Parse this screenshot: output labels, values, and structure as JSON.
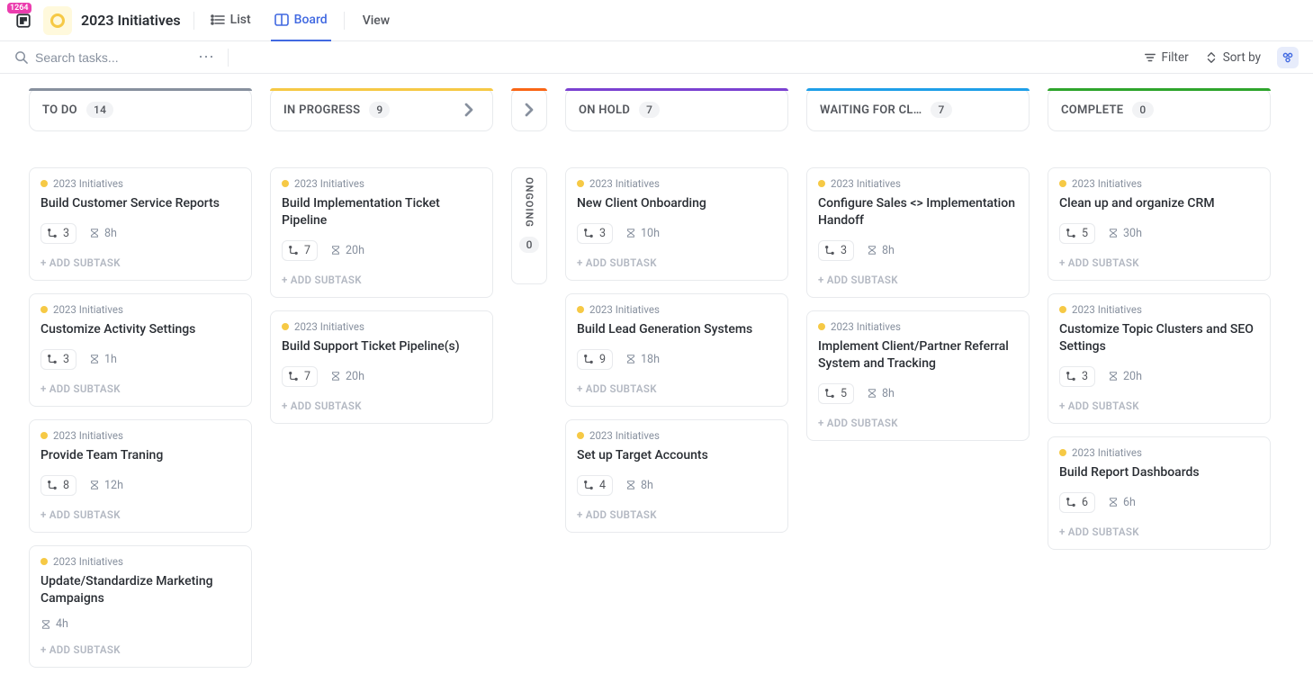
{
  "app_badge_count": "1264",
  "page_title": "2023 Initiatives",
  "tabs": {
    "list": "List",
    "board": "Board",
    "add_view": "View"
  },
  "toolbar": {
    "search_placeholder": "Search tasks...",
    "filter": "Filter",
    "sort": "Sort by"
  },
  "tag_label": "2023 Initiatives",
  "add_subtask_label": "+ ADD SUBTASK",
  "columns": {
    "todo": {
      "label": "TO DO",
      "count": "14"
    },
    "inprogress": {
      "label": "IN PROGRESS",
      "count": "9"
    },
    "ongoing": {
      "label": "ONGOING",
      "count": "0"
    },
    "onhold": {
      "label": "ON HOLD",
      "count": "7"
    },
    "waiting": {
      "label": "WAITING FOR CL…",
      "count": "7"
    },
    "complete": {
      "label": "COMPLETE",
      "count": "0"
    }
  },
  "cards": {
    "todo": [
      {
        "title": "Build Customer Service Reports",
        "sub": "3",
        "est": "8h"
      },
      {
        "title": "Customize Activity Settings",
        "sub": "3",
        "est": "1h"
      },
      {
        "title": "Provide Team Traning",
        "sub": "8",
        "est": "12h"
      },
      {
        "title": "Update/Standardize Marketing Campaigns",
        "est": "4h"
      }
    ],
    "inprogress": [
      {
        "title": "Build Implementation Ticket Pipeline",
        "sub": "7",
        "est": "20h"
      },
      {
        "title": "Build Support Ticket Pipeline(s)",
        "sub": "7",
        "est": "20h"
      }
    ],
    "onhold": [
      {
        "title": "New Client Onboarding",
        "sub": "3",
        "est": "10h"
      },
      {
        "title": "Build Lead Generation Systems",
        "sub": "9",
        "est": "18h"
      },
      {
        "title": "Set up Target Accounts",
        "sub": "4",
        "est": "8h"
      }
    ],
    "waiting": [
      {
        "title": "Configure Sales <> Implementation Handoff",
        "sub": "3",
        "est": "8h"
      },
      {
        "title": "Implement Client/Partner Referral System and Tracking",
        "sub": "5",
        "est": "8h"
      }
    ],
    "complete": [
      {
        "title": "Clean up and organize CRM",
        "sub": "5",
        "est": "30h"
      },
      {
        "title": "Customize Topic Clusters and SEO Settings",
        "sub": "3",
        "est": "20h"
      },
      {
        "title": "Build Report Dashboards",
        "sub": "6",
        "est": "6h"
      }
    ]
  }
}
